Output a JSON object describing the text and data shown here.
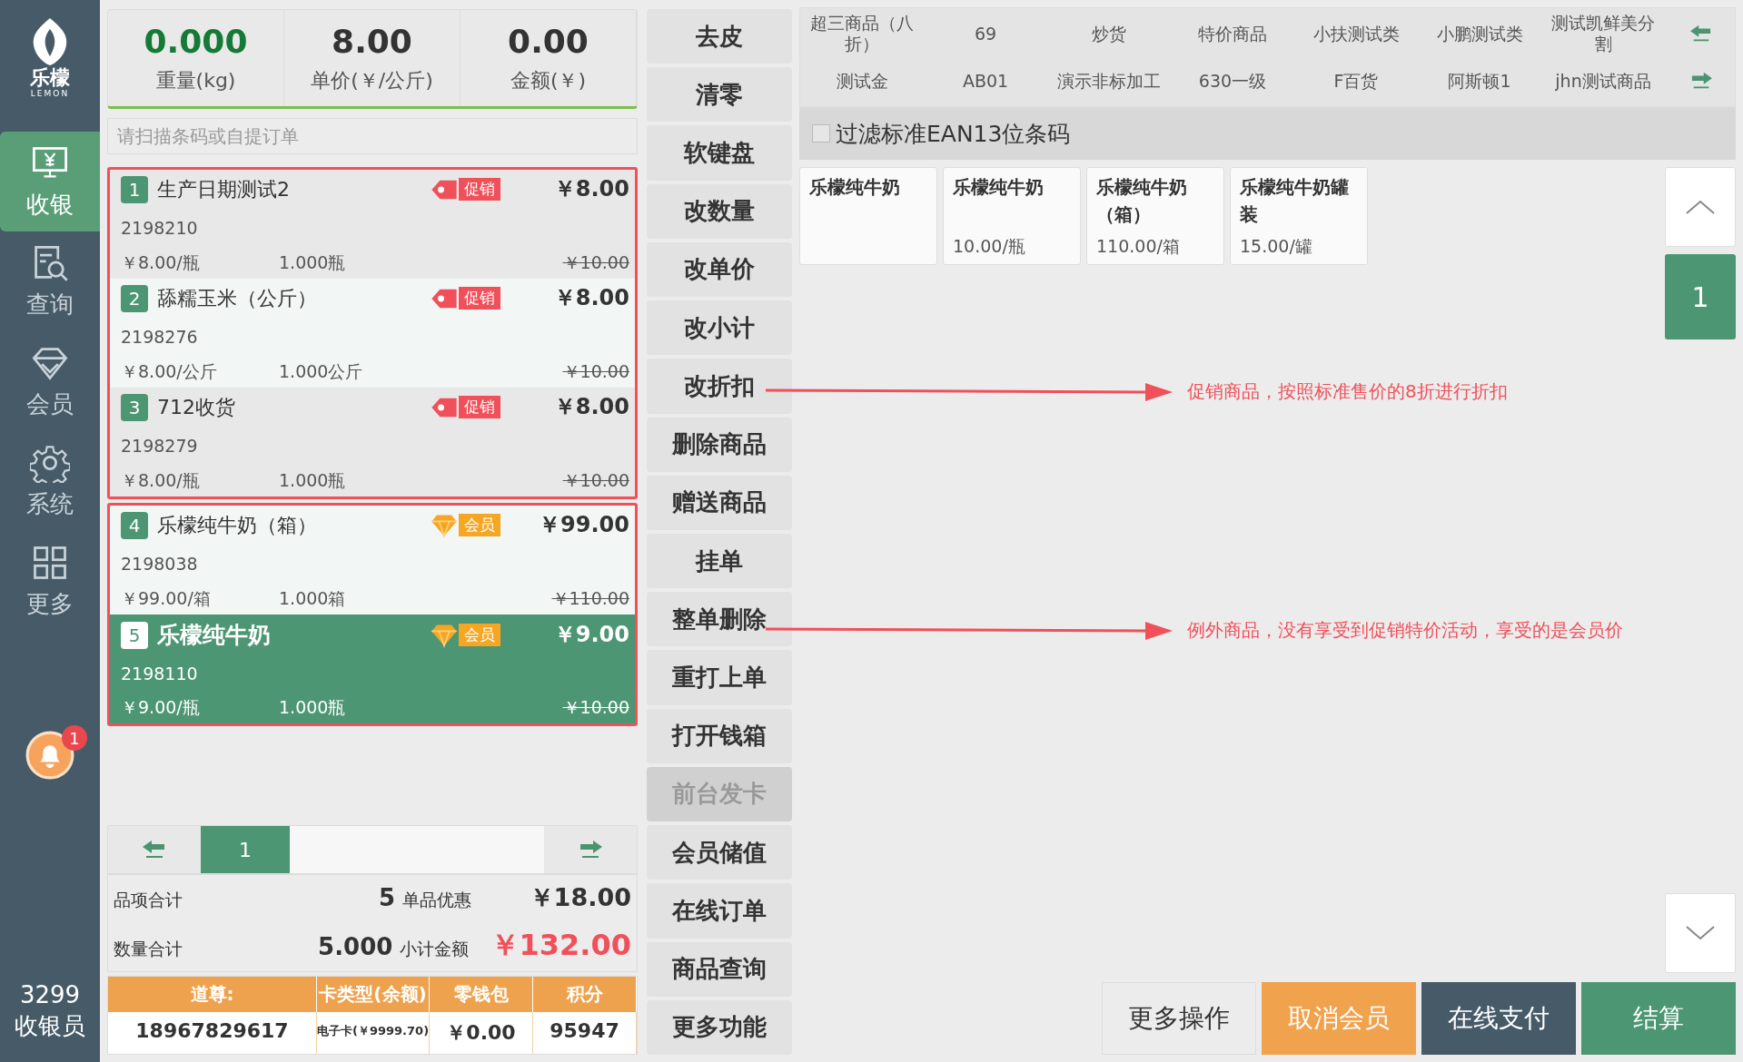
{
  "sidebar": {
    "brand": "乐檬",
    "brand_sub": "LEMON",
    "items": [
      {
        "label": "收银",
        "selected": true
      },
      {
        "label": "查询",
        "selected": false
      },
      {
        "label": "会员",
        "selected": false
      },
      {
        "label": "系统",
        "selected": false
      },
      {
        "label": "更多",
        "selected": false
      }
    ],
    "notification_count": "1",
    "user_id": "3299",
    "user_role": "收银员"
  },
  "scale": {
    "readouts": [
      {
        "value": "0.000",
        "label": "重量(kg)",
        "kind": "weight"
      },
      {
        "value": "8.00",
        "label": "单价(￥/公斤)",
        "kind": "plain"
      },
      {
        "value": "0.00",
        "label": "金额(￥)",
        "kind": "plain"
      }
    ]
  },
  "search": {
    "placeholder": "请扫描条码或自提订单"
  },
  "cart": {
    "groups": [
      {
        "items": [
          {
            "index": "1",
            "name": "生产日期测试2",
            "code": "2198210",
            "unit_price": "￥8.00/瓶",
            "qty": "1.000瓶",
            "price": "￥8.00",
            "original_price": "￥10.00",
            "tag": "促销",
            "kind": "promo",
            "selected": false
          },
          {
            "index": "2",
            "name": "舔糯玉米（公斤）",
            "code": "2198276",
            "unit_price": "￥8.00/公斤",
            "qty": "1.000公斤",
            "price": "￥8.00",
            "original_price": "￥10.00",
            "tag": "促销",
            "kind": "promo",
            "selected": false
          },
          {
            "index": "3",
            "name": "712收货",
            "code": "2198279",
            "unit_price": "￥8.00/瓶",
            "qty": "1.000瓶",
            "price": "￥8.00",
            "original_price": "￥10.00",
            "tag": "促销",
            "kind": "promo",
            "selected": false
          }
        ]
      },
      {
        "items": [
          {
            "index": "4",
            "name": "乐檬纯牛奶（箱）",
            "code": "2198038",
            "unit_price": "￥99.00/箱",
            "qty": "1.000箱",
            "price": "￥99.00",
            "original_price": "￥110.00",
            "tag": "会员",
            "kind": "member",
            "selected": false
          },
          {
            "index": "5",
            "name": "乐檬纯牛奶",
            "code": "2198110",
            "unit_price": "￥9.00/瓶",
            "qty": "1.000瓶",
            "price": "￥9.00",
            "original_price": "￥10.00",
            "tag": "会员",
            "kind": "member",
            "selected": true
          }
        ]
      }
    ]
  },
  "pager": {
    "pages": [
      {
        "label": "1",
        "selected": true
      }
    ]
  },
  "totals": {
    "items_label": "品项合计",
    "items_value": "5",
    "discount_label": "单品优惠",
    "discount_value": "￥18.00",
    "qty_label": "数量合计",
    "qty_value": "5.000",
    "subtotal_label": "小计金额",
    "subtotal_value": "￥132.00"
  },
  "member": {
    "columns": [
      "道尊:",
      "卡类型(余额)",
      "零钱包",
      "积分"
    ],
    "values": [
      "18967829617",
      "电子卡(￥9999.70)",
      "￥0.00",
      "95947"
    ]
  },
  "actions": [
    {
      "label": "去皮",
      "disabled": false
    },
    {
      "label": "清零",
      "disabled": false
    },
    {
      "label": "软键盘",
      "disabled": false
    },
    {
      "label": "改数量",
      "disabled": false
    },
    {
      "label": "改单价",
      "disabled": false
    },
    {
      "label": "改小计",
      "disabled": false
    },
    {
      "label": "改折扣",
      "disabled": false
    },
    {
      "label": "删除商品",
      "disabled": false
    },
    {
      "label": "赠送商品",
      "disabled": false
    },
    {
      "label": "挂单",
      "disabled": false
    },
    {
      "label": "整单删除",
      "disabled": false
    },
    {
      "label": "重打上单",
      "disabled": false
    },
    {
      "label": "打开钱箱",
      "disabled": false
    },
    {
      "label": "前台发卡",
      "disabled": true
    },
    {
      "label": "会员储值",
      "disabled": false
    },
    {
      "label": "在线订单",
      "disabled": false
    },
    {
      "label": "商品查询",
      "disabled": false
    },
    {
      "label": "更多功能",
      "disabled": false
    }
  ],
  "categories": {
    "rows": [
      [
        "超三商品（八折）",
        "69",
        "炒货",
        "特价商品",
        "小扶测试类",
        "小鹏测试类",
        "测试凯鲜美分割"
      ],
      [
        "测试金",
        "AB01",
        "演示非标加工",
        "630一级",
        "F百货",
        "阿斯顿1",
        "jhn测试商品"
      ]
    ]
  },
  "filter": {
    "label": "过滤标准EAN13位条码",
    "checked": false
  },
  "products": [
    {
      "name": "乐檬纯牛奶"
    },
    {
      "name": "乐檬纯牛奶",
      "price": "10.00/瓶"
    },
    {
      "name": "乐檬纯牛奶（箱）",
      "price": "110.00/箱"
    },
    {
      "name": "乐檬纯牛奶罐装",
      "price": "15.00/罐"
    }
  ],
  "product_page": "1",
  "footer_buttons": [
    {
      "label": "更多操作",
      "kind": "plain"
    },
    {
      "label": "取消会员",
      "kind": "warning"
    },
    {
      "label": "在线支付",
      "kind": "dark"
    },
    {
      "label": "结算",
      "kind": "primary"
    }
  ],
  "annotations": [
    {
      "text": "促销商品，按照标准售价的8折进行折扣"
    },
    {
      "text": "例外商品，没有享受到促销特价活动，享受的是会员价"
    }
  ]
}
